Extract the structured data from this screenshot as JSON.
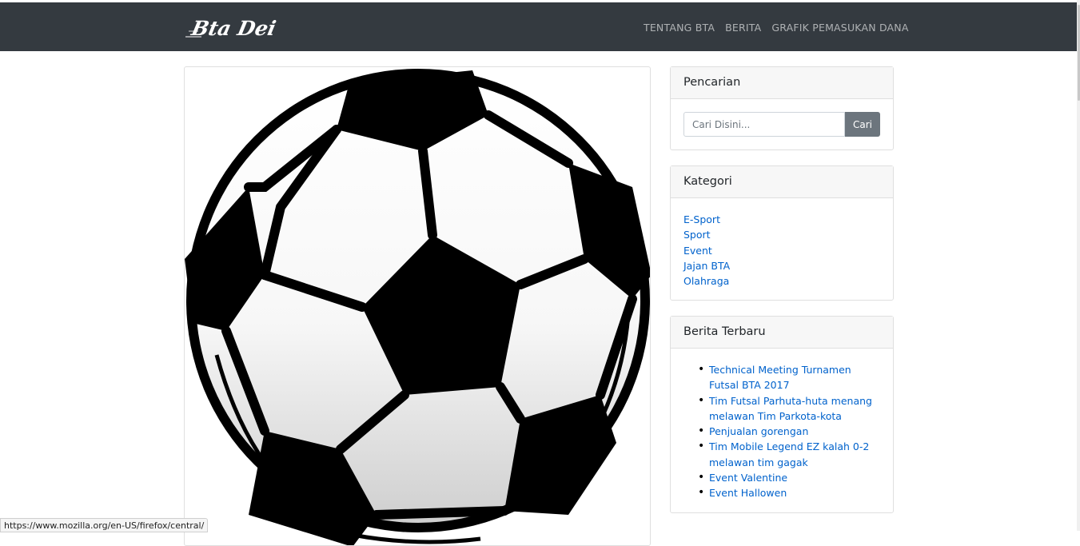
{
  "navbar": {
    "brand": "Bta Dei",
    "links": [
      "TENTANG BTA",
      "BERITA",
      "GRAFIK PEMASUKAN DANA"
    ]
  },
  "post": {
    "image": "soccer-ball-image"
  },
  "search": {
    "title": "Pencarian",
    "placeholder": "Cari Disini...",
    "button": "Cari"
  },
  "categories": {
    "title": "Kategori",
    "items": [
      "E-Sport",
      "Sport",
      "Event",
      "Jajan BTA",
      "Olahraga"
    ]
  },
  "latest": {
    "title": "Berita Terbaru",
    "items": [
      "Technical Meeting Turnamen Futsal BTA 2017",
      "Tim Futsal Parhuta-huta menang melawan Tim Parkota-kota",
      "Penjualan gorengan",
      "Tim Mobile Legend EZ kalah 0-2 melawan tim gagak",
      "Event Valentine",
      "Event Hallowen"
    ]
  },
  "statusbar": {
    "url": "https://www.mozilla.org/en-US/firefox/central/"
  },
  "colors": {
    "navbar_bg": "#343a40",
    "link": "#0062cc",
    "button_bg": "#6c757d"
  }
}
